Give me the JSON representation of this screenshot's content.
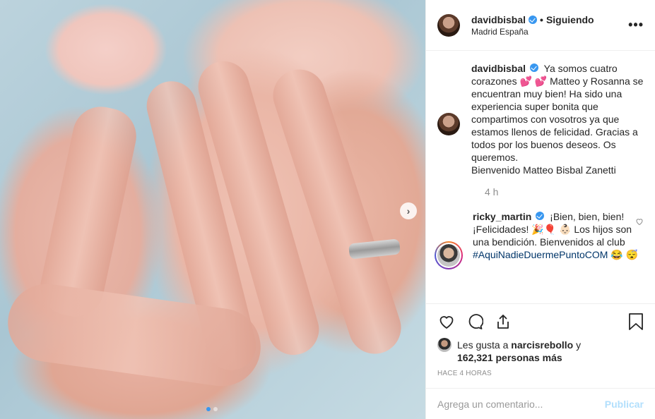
{
  "post": {
    "username": "davidbisbal",
    "follow_label": "Siguiendo",
    "separator": "•",
    "location": "Madrid España",
    "more_label": "•••"
  },
  "caption": {
    "username": "davidbisbal",
    "text": "Ya somos cuatro corazones 💕 💕 Matteo y Rosanna se encuentran muy bien! Ha sido una experiencia super bonita que compartimos con vosotros ya que estamos llenos de felicidad. Gracias a todos por los buenos deseos. Os queremos.",
    "text2": "Bienvenido Matteo Bisbal Zanetti",
    "time": "4 h"
  },
  "comment": {
    "username": "ricky_martin",
    "text": "¡Bien, bien, bien!¡Felicidades! 🎉🎈 👶🏻 Los hijos son una bendición. Bienvenidos al club",
    "hashtag": "#AquiNadieDuermePuntoCOM",
    "emoji_end": "😂 😴"
  },
  "likes": {
    "prefix": "Les gusta a",
    "user": "narcisrebollo",
    "conj": "y",
    "count": "162,321 personas más"
  },
  "ago": "HACE 4 HORAS",
  "add_comment": {
    "placeholder": "Agrega un comentario...",
    "publish_label": "Publicar"
  },
  "carousel": {
    "total": 2,
    "active": 1
  },
  "colors": {
    "accent": "#3897f0",
    "publish_disabled": "#b2dffc",
    "muted": "#8e8e8e"
  }
}
